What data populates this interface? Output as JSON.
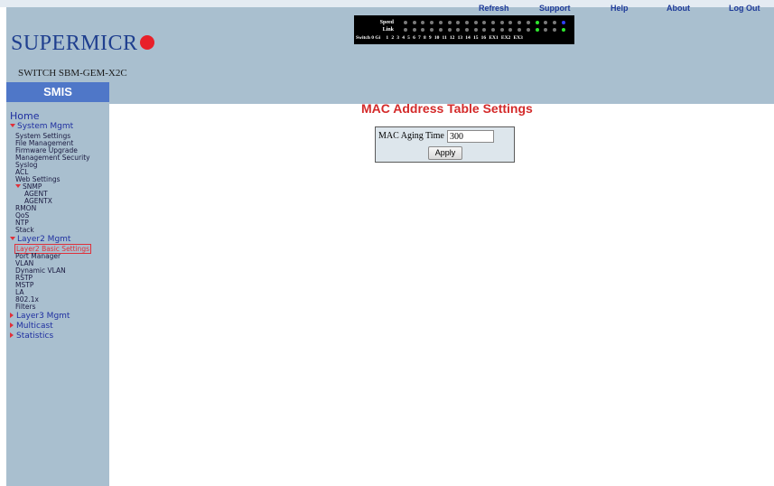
{
  "topnav": {
    "refresh": "Refresh",
    "support": "Support",
    "help": "Help",
    "about": "About",
    "logout": "Log Out"
  },
  "brand": {
    "logo_text": "SUPERMICR",
    "logo_dot_color": "#e8202a",
    "model": "SWITCH SBM-GEM-X2C",
    "product": "SMIS"
  },
  "port_panel": {
    "speed_label": "Speed",
    "link_label": "Link",
    "switch_label": "Switch 0 Gi",
    "ports": [
      "1",
      "2",
      "3",
      "4",
      "5",
      "6",
      "7",
      "8",
      "9",
      "10",
      "11",
      "12",
      "13",
      "14",
      "15",
      "16",
      "EX1",
      "EX2",
      "EX3"
    ],
    "speed_leds": [
      "off",
      "off",
      "off",
      "off",
      "off",
      "off",
      "off",
      "off",
      "off",
      "off",
      "off",
      "off",
      "off",
      "off",
      "off",
      "green",
      "off",
      "off",
      "blue"
    ],
    "link_leds": [
      "off",
      "off",
      "off",
      "off",
      "off",
      "off",
      "off",
      "off",
      "off",
      "off",
      "off",
      "off",
      "off",
      "off",
      "off",
      "green",
      "off",
      "off",
      "green"
    ]
  },
  "sidebar": {
    "home": "Home",
    "system_mgmt": "System Mgmt",
    "system_items": [
      "System Settings",
      "File Management",
      "Firmware Upgrade",
      "Management Security",
      "Syslog",
      "ACL",
      "Web Settings"
    ],
    "snmp": "SNMP",
    "snmp_items": [
      "AGENT",
      "AGENTX"
    ],
    "system_items2": [
      "RMON",
      "QoS",
      "NTP",
      "Stack"
    ],
    "layer2_mgmt": "Layer2 Mgmt",
    "layer2_selected": "Layer2 Basic Settings",
    "layer2_items": [
      "Port Manager",
      "VLAN",
      "Dynamic VLAN",
      "RSTP",
      "MSTP",
      "LA",
      "802.1x",
      "Filters"
    ],
    "layer3_mgmt": "Layer3 Mgmt",
    "multicast": "Multicast",
    "statistics": "Statistics"
  },
  "main": {
    "title": "MAC Address Table Settings",
    "aging_label": "MAC Aging Time",
    "aging_value": "300",
    "apply_label": "Apply"
  },
  "colors": {
    "header_bg": "#a9bfcf",
    "smis_bg": "#4f77c8",
    "title_red": "#d42a2a",
    "nav_blue": "#1f2fa0"
  }
}
